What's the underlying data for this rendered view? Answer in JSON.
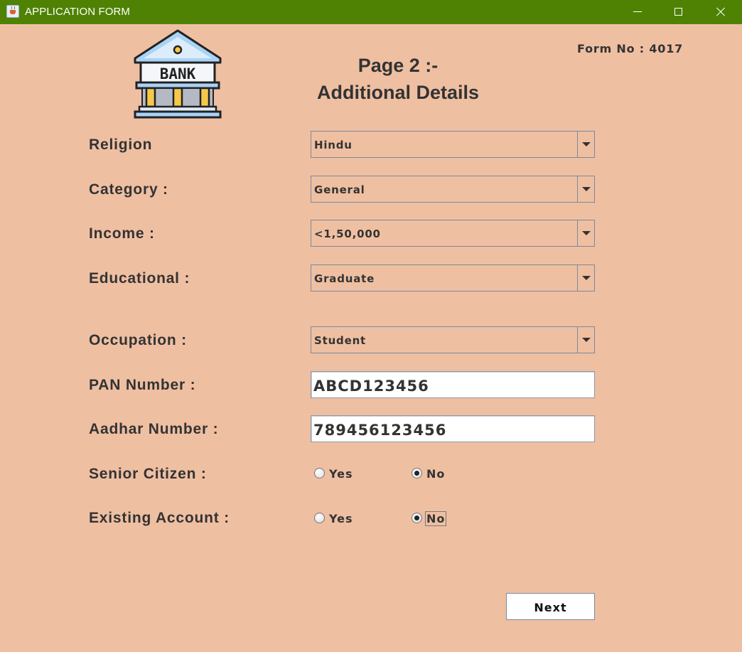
{
  "window": {
    "title": "APPLICATION FORM"
  },
  "header": {
    "logo_text": "BANK",
    "form_no": "Form No : 4017",
    "page_title_line1": "Page 2 :-",
    "page_title_line2": "Additional Details"
  },
  "fields": {
    "religion": {
      "label": "Religion",
      "value": "Hindu"
    },
    "category": {
      "label": "Category :",
      "value": "General"
    },
    "income": {
      "label": "Income :",
      "value": "<1,50,000"
    },
    "educational": {
      "label": "Educational :",
      "value": "Graduate"
    },
    "occupation": {
      "label": "Occupation :",
      "value": "Student"
    },
    "pan": {
      "label": "PAN Number :",
      "value": "ABCD123456"
    },
    "aadhar": {
      "label": "Aadhar Number :",
      "value": "789456123456"
    },
    "senior_citizen": {
      "label": "Senior Citizen :",
      "yes": "Yes",
      "no": "No",
      "selected": "No"
    },
    "existing_account": {
      "label": "Existing Account :",
      "yes": "Yes",
      "no": "No",
      "selected": "No"
    }
  },
  "actions": {
    "next_label": "Next"
  },
  "colors": {
    "titlebar": "#4f8203",
    "background": "#efbfa2"
  }
}
